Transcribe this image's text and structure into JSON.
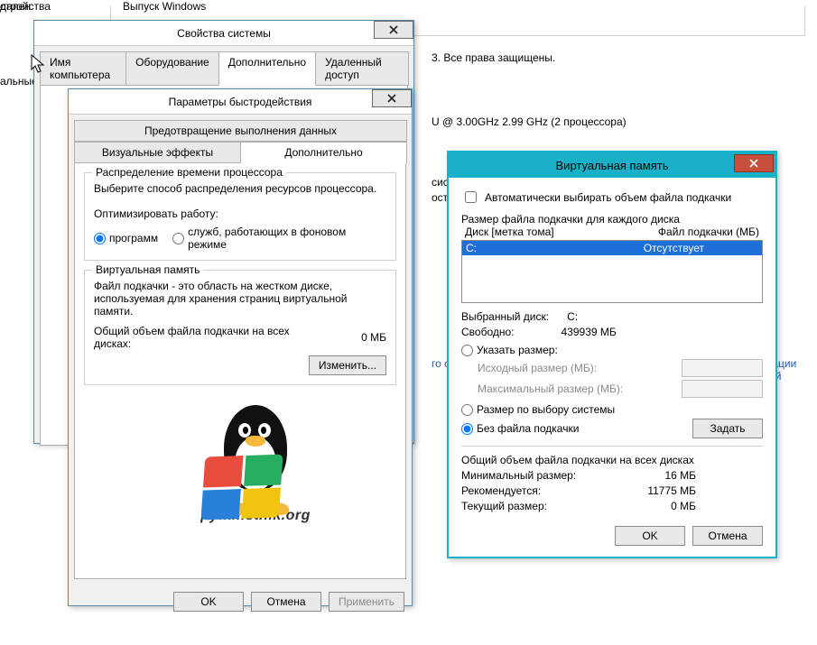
{
  "background": {
    "left_fragments": [
      "стройства",
      "дален",
      "альные p"
    ],
    "windows_edition_label": "Выпуск Windows",
    "rights_fragment": "3. Все права защищены.",
    "cpu_fragment": "U @ 3.00GHz  2.99 GHz (2 процессора)",
    "syst_fragment": "сист",
    "ostup_fragment": "оступ",
    "link1_fragment": "го со",
    "link2_fragment": "орации Май"
  },
  "sysprops": {
    "title": "Свойства системы",
    "tabs": {
      "computer_name": "Имя компьютера",
      "hardware": "Оборудование",
      "advanced": "Дополнительно",
      "remote": "Удаленный доступ"
    }
  },
  "perf": {
    "title": "Параметры быстродействия",
    "tab_dep": "Предотвращение выполнения данных",
    "tab_visual": "Визуальные эффекты",
    "tab_advanced": "Дополнительно",
    "sched_group": "Распределение времени процессора",
    "sched_desc": "Выберите способ распределения ресурсов процессора.",
    "optimize_label": "Оптимизировать работу:",
    "radio_programs": "программ",
    "radio_services": "служб, работающих в фоновом режиме",
    "vm_group": "Виртуальная память",
    "vm_desc": "Файл подкачки - это область на жестком диске, используемая для хранения страниц виртуальной памяти.",
    "vm_total_label": "Общий объем файла подкачки на всех дисках:",
    "vm_total_value": "0 МБ",
    "change_btn": "Изменить...",
    "ok": "OK",
    "cancel": "Отмена",
    "apply": "Применить",
    "logo_text": "pyatilistnik.org"
  },
  "vm": {
    "title": "Виртуальная память",
    "auto_checkbox": "Автоматически выбирать объем файла подкачки",
    "size_each_label": "Размер файла подкачки для каждого диска",
    "col_disk": "Диск [метка тома]",
    "col_pagefile": "Файл подкачки (МБ)",
    "row_drive": "C:",
    "row_status": "Отсутствует",
    "selected_label": "Выбранный диск:",
    "selected_value": "C:",
    "free_label": "Свободно:",
    "free_value": "439939 МБ",
    "radio_custom": "Указать размер:",
    "initial_label": "Исходный размер (МБ):",
    "max_label": "Максимальный размер (МБ):",
    "radio_system": "Размер по выбору системы",
    "radio_none": "Без файла подкачки",
    "set_btn": "Задать",
    "total_all_label": "Общий объем файла подкачки на всех дисках",
    "min_label": "Минимальный размер:",
    "min_value": "16 МБ",
    "rec_label": "Рекомендуется:",
    "rec_value": "11775 МБ",
    "cur_label": "Текущий размер:",
    "cur_value": "0 МБ",
    "ok": "OK",
    "cancel": "Отмена"
  }
}
